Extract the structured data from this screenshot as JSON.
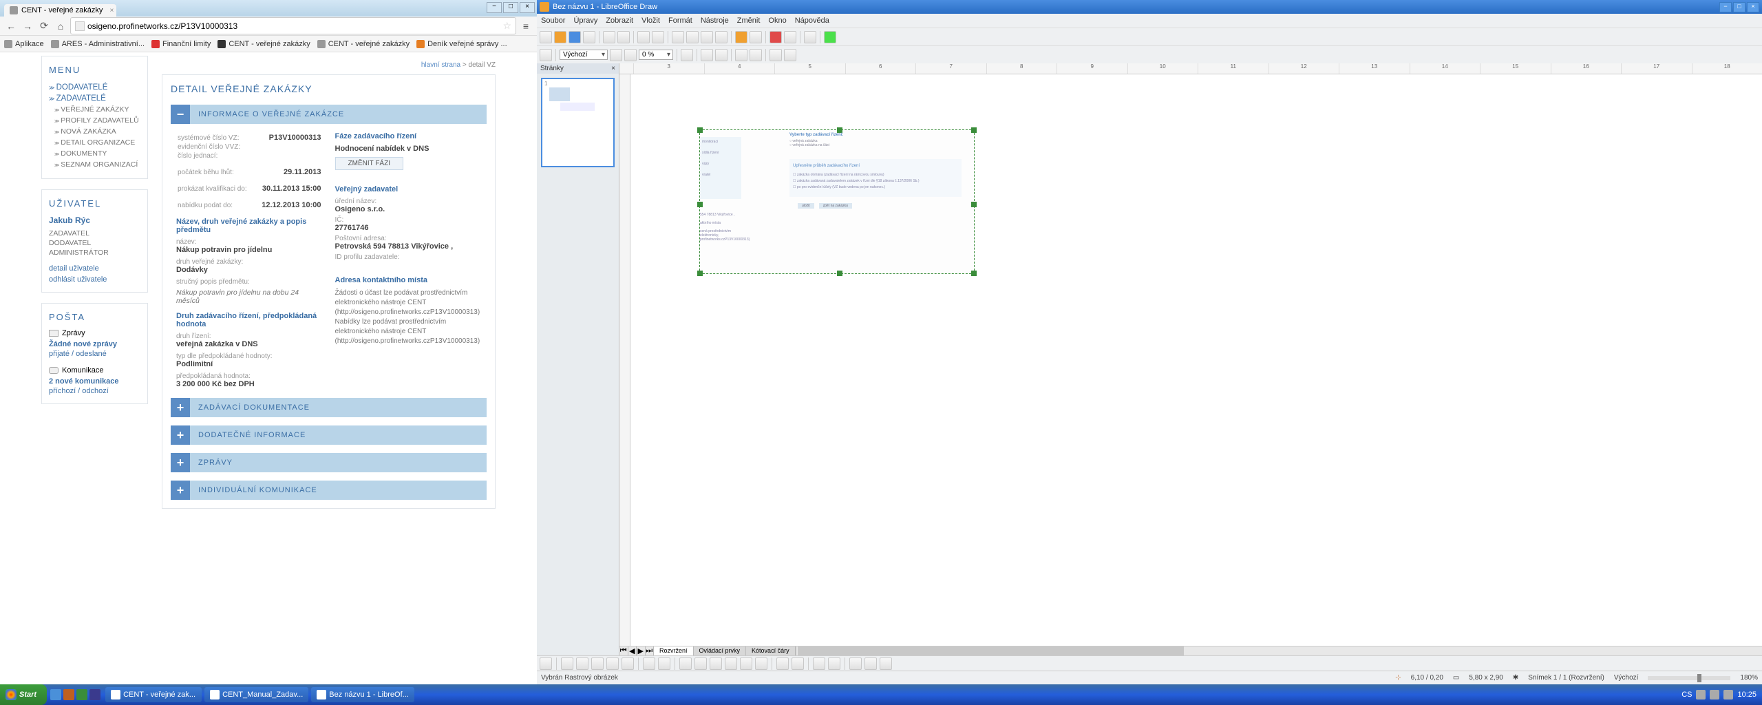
{
  "chrome": {
    "tab_title": "CENT - veřejné zakázky",
    "url": "osigeno.profinetworks.cz/P13V10000313",
    "bookmarks": {
      "apps": "Aplikace",
      "b1": "ARES - Administrativní...",
      "b2": "Finanční limity",
      "b3": "CENT - veřejné zakázky",
      "b4": "CENT - veřejné zakázky",
      "b5": "Deník veřejné správy ..."
    }
  },
  "nav": {
    "menu_title": "MENU",
    "dodavatele": "DODAVATELÉ",
    "zadavatele": "ZADAVATELÉ",
    "sub1": "VEŘEJNÉ ZAKÁZKY",
    "sub2": "PROFILY ZADAVATELŮ",
    "sub3": "NOVÁ ZAKÁZKA",
    "sub4": "DETAIL ORGANIZACE",
    "sub5": "DOKUMENTY",
    "sub6": "SEZNAM ORGANIZACÍ"
  },
  "user": {
    "title": "UŽIVATEL",
    "name": "Jakub Rýc",
    "r1": "ZADAVATEL",
    "r2": "DODAVATEL",
    "r3": "ADMINISTRÁTOR",
    "detail": "detail uživatele",
    "logout": "odhlásit uživatele"
  },
  "mail": {
    "title": "POŠTA",
    "zpravy": "Zprávy",
    "none": "Žádné nové zprávy",
    "inout": "přijaté / odeslané",
    "kom": "Komunikace",
    "count": "2 nové komunikace",
    "inout2": "příchozí / odchozí"
  },
  "bc": {
    "home": "hlavní strana",
    "here": "detail VZ"
  },
  "pg": {
    "title": "DETAIL VEŘEJNÉ ZAKÁZKY",
    "info_h": "INFORMACE O VEŘEJNÉ ZAKÁZCE",
    "l_sysid": "systémové číslo VZ:",
    "v_sysid": "P13V10000313",
    "l_evid": "evidenční číslo VVZ:",
    "l_jednaci": "číslo jednací:",
    "l_lhuty": "počátek běhu lhůt:",
    "v_lhuty": "29.11.2013",
    "l_kval": "prokázat kvalifikaci do:",
    "v_kval": "30.11.2013 15:00",
    "l_nab": "nabídku podat do:",
    "v_nab": "12.12.2013 10:00",
    "h_faze": "Fáze zadávacího řízení",
    "v_faze": "Hodnocení nabídek v DNS",
    "btn_faze": "ZMĚNIT FÁZI",
    "h_zadavatel": "Veřejný zadavatel",
    "l_nazev_ured": "úřední název:",
    "v_nazev_ured": "Osigeno s.r.o.",
    "l_ic": "IČ:",
    "v_ic": "27761746",
    "l_adresa": "Poštovní adresa:",
    "v_adresa": "Petrovská 594 78813 Vikýřovice ,",
    "l_profil": "ID profilu zadavatele:",
    "h_nazev": "Název, druh veřejné zakázky a popis předmětu",
    "l_name": "název:",
    "v_name": "Nákup potravin pro jídelnu",
    "l_druh": "druh veřejné zakázky:",
    "v_druh": "Dodávky",
    "l_popis": "stručný popis předmětu:",
    "v_popis": "Nákup potravin pro jídelnu na dobu 24 měsíců",
    "h_druhrizeni": "Druh zadávacího řízení, předpokládaná hodnota",
    "l_rizeni": "druh řízení:",
    "v_rizeni": "veřejná zakázka v DNS",
    "l_typ": "typ dle předpokládané hodnoty:",
    "v_typ": "Podlimitní",
    "l_hodnota": "předpokládaná hodnota:",
    "v_hodnota": "3 200 000 Kč bez DPH",
    "h_kontakt": "Adresa kontaktního místa",
    "addr_text": "Žádosti o účast lze podávat prostřednictvím elektronického nástroje CENT (http://osigeno.profinetworks.czP13V10000313) Nabídky lze podávat prostřednictvím elektronického nástroje CENT (http://osigeno.profinetworks.czP13V10000313)",
    "p2": "ZADÁVACÍ DOKUMENTACE",
    "p3": "DODATEČNÉ INFORMACE",
    "p4": "ZPRÁVY",
    "p5": "INDIVIDUÁLNÍ KOMUNIKACE"
  },
  "lo": {
    "title": "Bez názvu 1 - LibreOffice Draw",
    "menu": {
      "m1": "Soubor",
      "m2": "Úpravy",
      "m3": "Zobrazit",
      "m4": "Vložit",
      "m5": "Formát",
      "m6": "Nástroje",
      "m7": "Změnit",
      "m8": "Okno",
      "m9": "Nápověda"
    },
    "style_combo": "Výchozí",
    "zoom_combo": "0 %",
    "slides_title": "Stránky",
    "tabs": {
      "t1": "Rozvržení",
      "t2": "Ovládací prvky",
      "t3": "Kótovací čáry"
    },
    "status": {
      "sel": "Vybrán Rastrový obrázek",
      "pos": "6,10 / 0,20",
      "size": "5,80 x 2,90",
      "slide": "Snímek 1 / 1 (Rozvržení)",
      "layout": "Výchozí",
      "zoom": "180%"
    },
    "img": {
      "h1": "Vyberte typ zadávací řízení:",
      "opt1": "veřejná zakázka",
      "opt2": "veřejná zakázka na část",
      "h2": "Upřesněte průběh zadávacího řízení",
      "c1": "zakázka otvírána (zadávací řízení na rámcovou smlouvu)",
      "c2": "zakázka zadávaná zadavatelem zakázek v řízni dle §18 zákona č.137/2006 Sb.)",
      "c3": "po pro evidenční účely (VZ bude vedena po jen nakonec.)",
      "btn1": "uložit",
      "btn2": "zpět na zakázku",
      "side1": "monitoraci",
      "side2": "sídla řízení",
      "side3": "vázy",
      "side4": "vratel",
      "side5": "554 78813 Vikýřovice ,",
      "side6": "aktního místa",
      "side7": "cená prosřednictvím elektronicky,",
      "side8": "profinetworks.czP13V10000313)"
    }
  },
  "ruler": {
    "r3": "3",
    "r4": "4",
    "r5": "5",
    "r6": "6",
    "r7": "7",
    "r8": "8",
    "r9": "9",
    "r10": "10",
    "r11": "11",
    "r12": "12",
    "r13": "13",
    "r14": "14",
    "r15": "15",
    "r16": "16",
    "r17": "17",
    "r18": "18"
  },
  "task": {
    "start": "Start",
    "t1": "CENT - veřejné zak...",
    "t2": "CENT_Manual_Zadav...",
    "t3": "Bez názvu 1 - LibreOf...",
    "lang": "CS",
    "time": "10:25"
  }
}
